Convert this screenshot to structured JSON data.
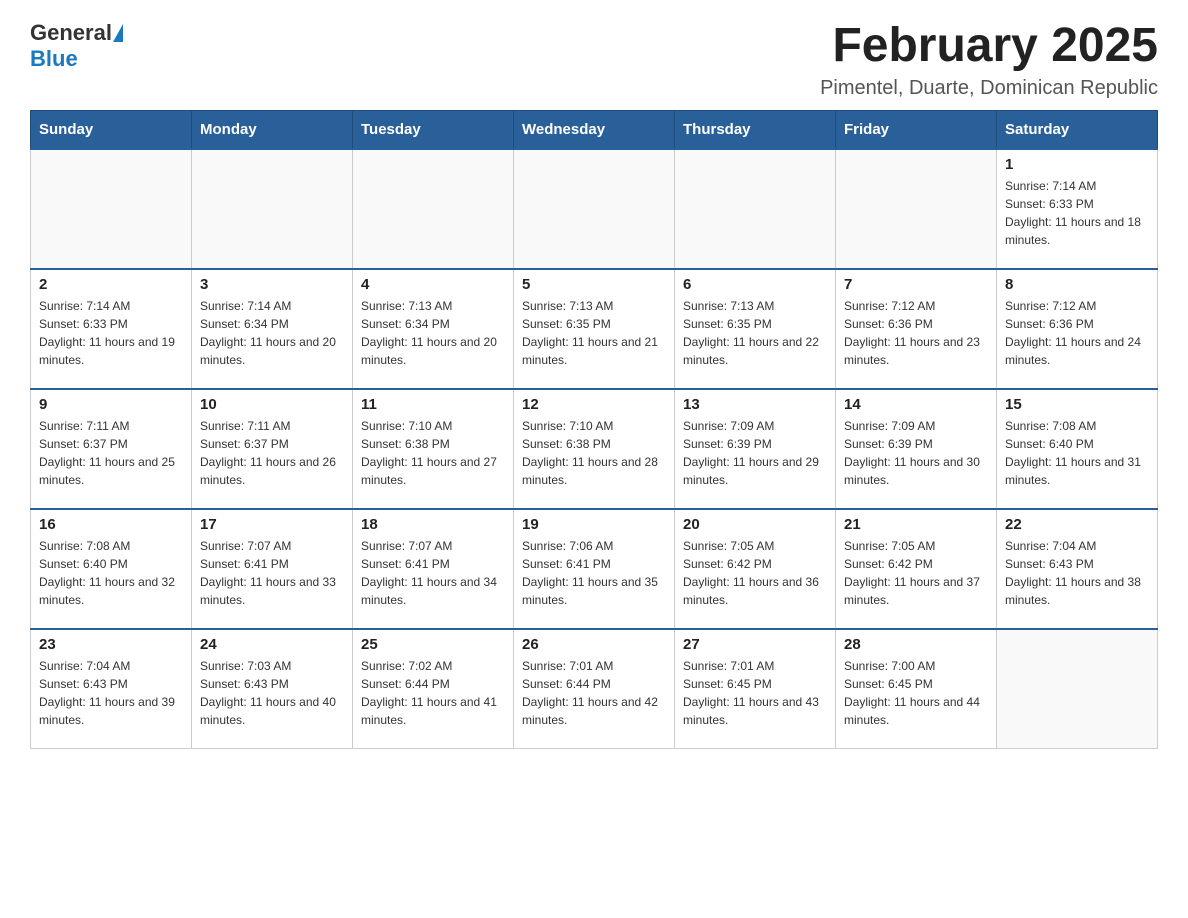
{
  "logo": {
    "general": "General",
    "blue": "Blue"
  },
  "title": "February 2025",
  "location": "Pimentel, Duarte, Dominican Republic",
  "days_of_week": [
    "Sunday",
    "Monday",
    "Tuesday",
    "Wednesday",
    "Thursday",
    "Friday",
    "Saturday"
  ],
  "weeks": [
    [
      {
        "day": "",
        "info": ""
      },
      {
        "day": "",
        "info": ""
      },
      {
        "day": "",
        "info": ""
      },
      {
        "day": "",
        "info": ""
      },
      {
        "day": "",
        "info": ""
      },
      {
        "day": "",
        "info": ""
      },
      {
        "day": "1",
        "info": "Sunrise: 7:14 AM\nSunset: 6:33 PM\nDaylight: 11 hours and 18 minutes."
      }
    ],
    [
      {
        "day": "2",
        "info": "Sunrise: 7:14 AM\nSunset: 6:33 PM\nDaylight: 11 hours and 19 minutes."
      },
      {
        "day": "3",
        "info": "Sunrise: 7:14 AM\nSunset: 6:34 PM\nDaylight: 11 hours and 20 minutes."
      },
      {
        "day": "4",
        "info": "Sunrise: 7:13 AM\nSunset: 6:34 PM\nDaylight: 11 hours and 20 minutes."
      },
      {
        "day": "5",
        "info": "Sunrise: 7:13 AM\nSunset: 6:35 PM\nDaylight: 11 hours and 21 minutes."
      },
      {
        "day": "6",
        "info": "Sunrise: 7:13 AM\nSunset: 6:35 PM\nDaylight: 11 hours and 22 minutes."
      },
      {
        "day": "7",
        "info": "Sunrise: 7:12 AM\nSunset: 6:36 PM\nDaylight: 11 hours and 23 minutes."
      },
      {
        "day": "8",
        "info": "Sunrise: 7:12 AM\nSunset: 6:36 PM\nDaylight: 11 hours and 24 minutes."
      }
    ],
    [
      {
        "day": "9",
        "info": "Sunrise: 7:11 AM\nSunset: 6:37 PM\nDaylight: 11 hours and 25 minutes."
      },
      {
        "day": "10",
        "info": "Sunrise: 7:11 AM\nSunset: 6:37 PM\nDaylight: 11 hours and 26 minutes."
      },
      {
        "day": "11",
        "info": "Sunrise: 7:10 AM\nSunset: 6:38 PM\nDaylight: 11 hours and 27 minutes."
      },
      {
        "day": "12",
        "info": "Sunrise: 7:10 AM\nSunset: 6:38 PM\nDaylight: 11 hours and 28 minutes."
      },
      {
        "day": "13",
        "info": "Sunrise: 7:09 AM\nSunset: 6:39 PM\nDaylight: 11 hours and 29 minutes."
      },
      {
        "day": "14",
        "info": "Sunrise: 7:09 AM\nSunset: 6:39 PM\nDaylight: 11 hours and 30 minutes."
      },
      {
        "day": "15",
        "info": "Sunrise: 7:08 AM\nSunset: 6:40 PM\nDaylight: 11 hours and 31 minutes."
      }
    ],
    [
      {
        "day": "16",
        "info": "Sunrise: 7:08 AM\nSunset: 6:40 PM\nDaylight: 11 hours and 32 minutes."
      },
      {
        "day": "17",
        "info": "Sunrise: 7:07 AM\nSunset: 6:41 PM\nDaylight: 11 hours and 33 minutes."
      },
      {
        "day": "18",
        "info": "Sunrise: 7:07 AM\nSunset: 6:41 PM\nDaylight: 11 hours and 34 minutes."
      },
      {
        "day": "19",
        "info": "Sunrise: 7:06 AM\nSunset: 6:41 PM\nDaylight: 11 hours and 35 minutes."
      },
      {
        "day": "20",
        "info": "Sunrise: 7:05 AM\nSunset: 6:42 PM\nDaylight: 11 hours and 36 minutes."
      },
      {
        "day": "21",
        "info": "Sunrise: 7:05 AM\nSunset: 6:42 PM\nDaylight: 11 hours and 37 minutes."
      },
      {
        "day": "22",
        "info": "Sunrise: 7:04 AM\nSunset: 6:43 PM\nDaylight: 11 hours and 38 minutes."
      }
    ],
    [
      {
        "day": "23",
        "info": "Sunrise: 7:04 AM\nSunset: 6:43 PM\nDaylight: 11 hours and 39 minutes."
      },
      {
        "day": "24",
        "info": "Sunrise: 7:03 AM\nSunset: 6:43 PM\nDaylight: 11 hours and 40 minutes."
      },
      {
        "day": "25",
        "info": "Sunrise: 7:02 AM\nSunset: 6:44 PM\nDaylight: 11 hours and 41 minutes."
      },
      {
        "day": "26",
        "info": "Sunrise: 7:01 AM\nSunset: 6:44 PM\nDaylight: 11 hours and 42 minutes."
      },
      {
        "day": "27",
        "info": "Sunrise: 7:01 AM\nSunset: 6:45 PM\nDaylight: 11 hours and 43 minutes."
      },
      {
        "day": "28",
        "info": "Sunrise: 7:00 AM\nSunset: 6:45 PM\nDaylight: 11 hours and 44 minutes."
      },
      {
        "day": "",
        "info": ""
      }
    ]
  ]
}
